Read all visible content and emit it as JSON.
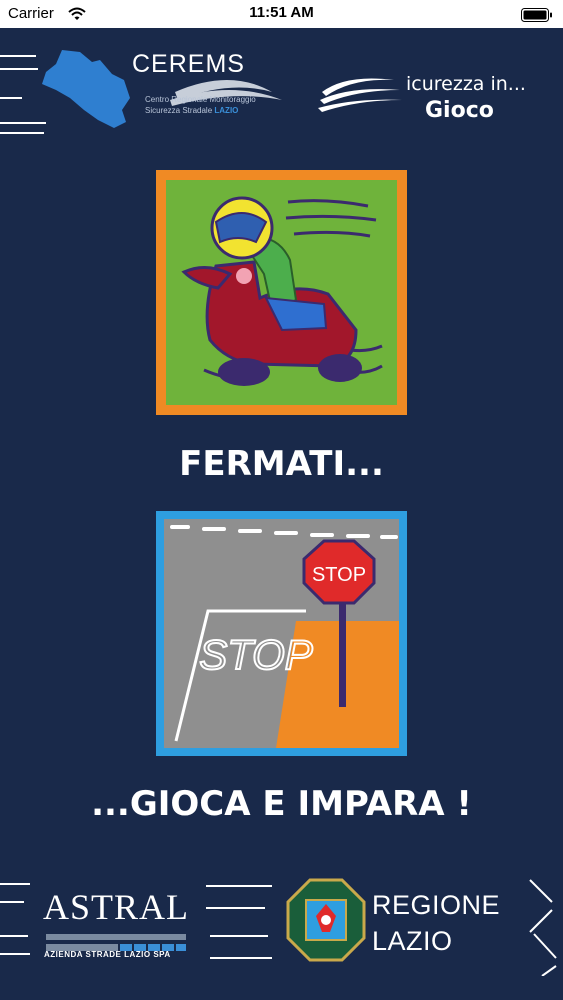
{
  "status_bar": {
    "carrier": "Carrier",
    "time": "11:51 AM"
  },
  "header": {
    "cerems": {
      "title": "CEREMS",
      "subtitle_line1": "Centro Regionale Monitoraggio",
      "subtitle_line2": "Sicurezza Stradale",
      "subtitle_region": "LAZIO"
    },
    "sicurezza": {
      "line1": "icurezza in...",
      "line2": "Gioco"
    }
  },
  "main": {
    "headline_1": "FERMATI...",
    "headline_2": "...GIOCA E IMPARA !",
    "stop_sign_text": "STOP",
    "road_marking_text": "STOP"
  },
  "footer": {
    "astral": {
      "name": "ASTRAL",
      "subtitle": "AZIENDA STRADE LAZIO SPA"
    },
    "regione": {
      "line1": "REGIONE",
      "line2": "LAZIO"
    }
  },
  "colors": {
    "background": "#19294a",
    "moto_tile_border": "#f08a24",
    "moto_tile_fill": "#6fb33b",
    "stop_tile_border": "#2e9ee0",
    "road_gray": "#8f8f8f",
    "stop_sign_red": "#e02a2a",
    "accent_blue": "#3a8fd8"
  }
}
